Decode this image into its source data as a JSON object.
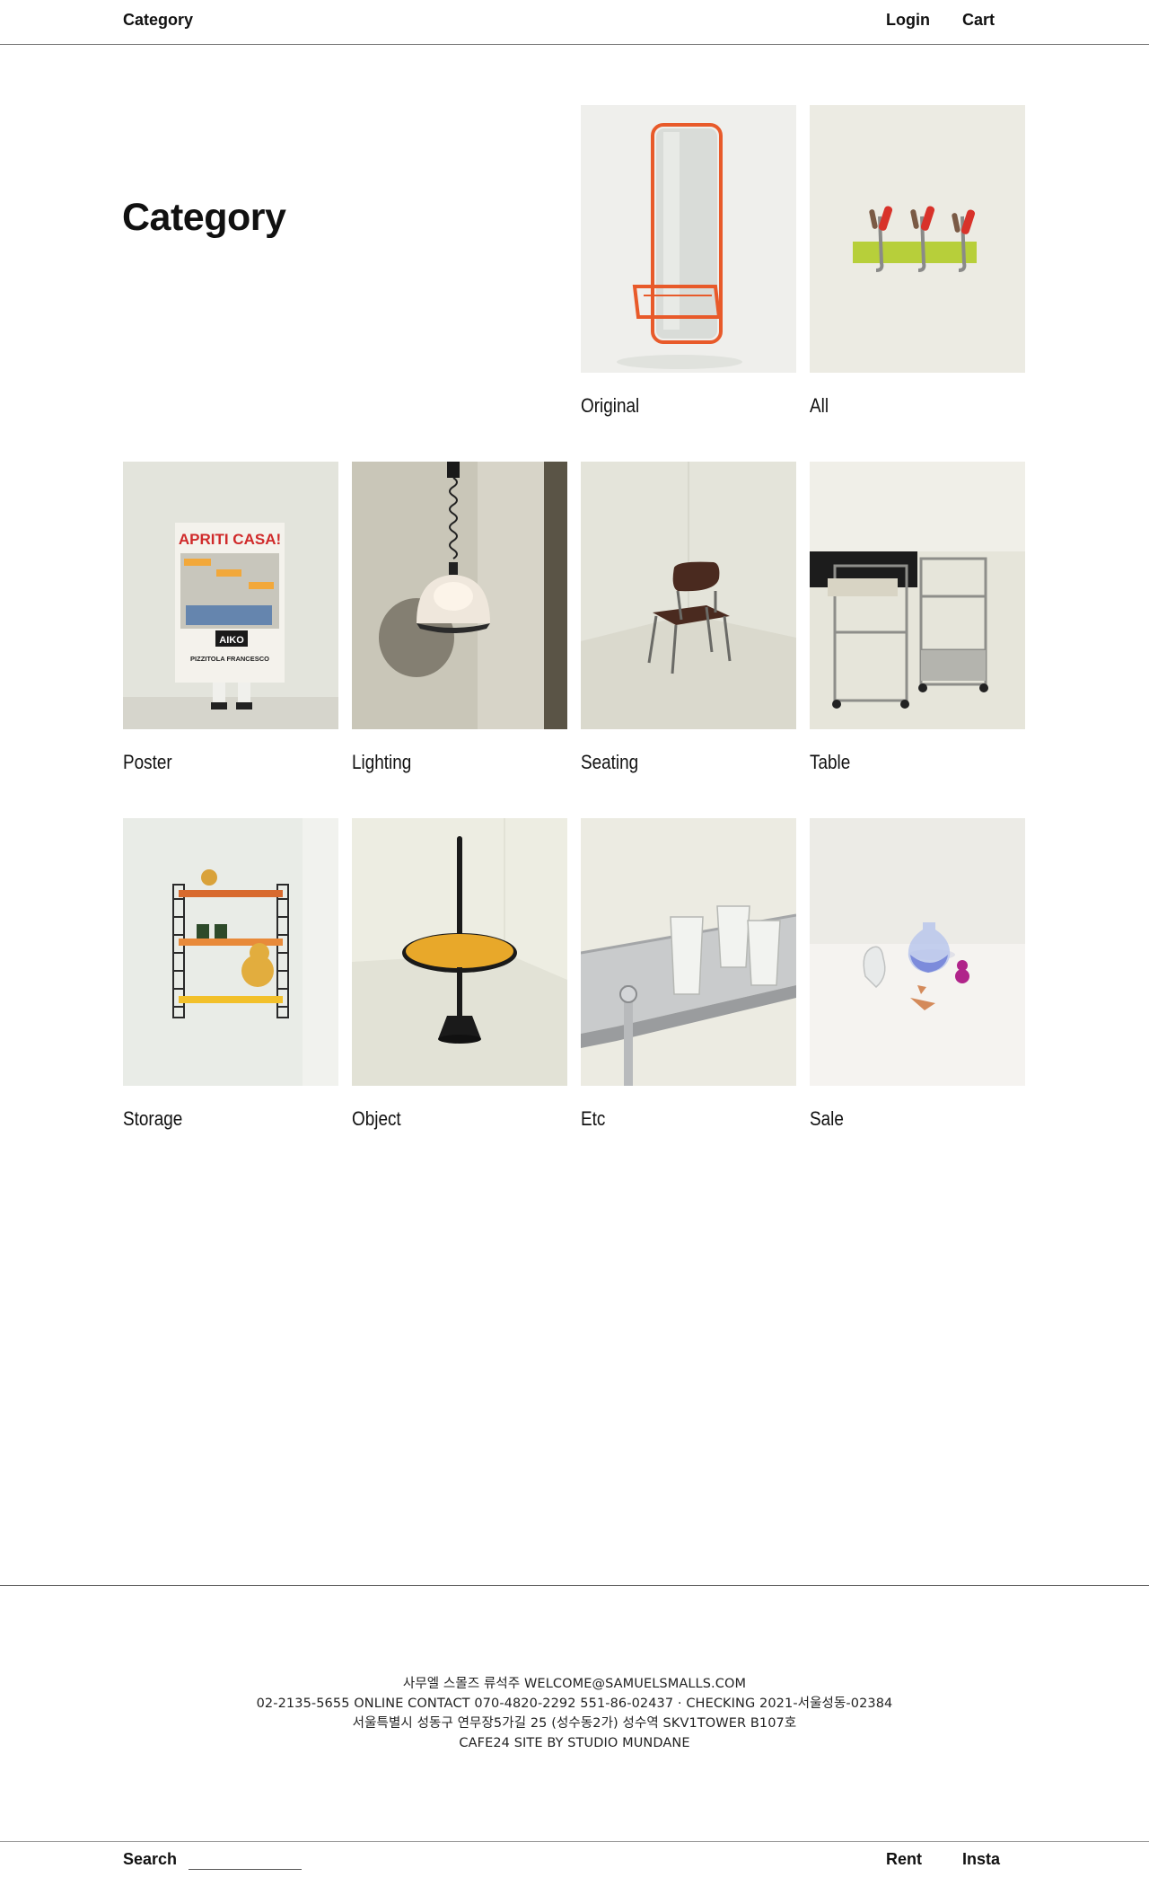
{
  "header": {
    "category_link": "Category",
    "login_link": "Login",
    "cart_link": "Cart"
  },
  "page_title": "Category",
  "categories": [
    {
      "label": "Original",
      "image_icon": "orange-mirror-photo"
    },
    {
      "label": "All",
      "image_icon": "wall-hooks-photo"
    },
    {
      "label": "Poster",
      "image_icon": "poster-photo"
    },
    {
      "label": "Lighting",
      "image_icon": "pendant-lamp-photo"
    },
    {
      "label": "Seating",
      "image_icon": "chair-photo"
    },
    {
      "label": "Table",
      "image_icon": "trolley-tables-photo"
    },
    {
      "label": "Storage",
      "image_icon": "wall-shelf-photo"
    },
    {
      "label": "Object",
      "image_icon": "side-table-photo"
    },
    {
      "label": "Etc",
      "image_icon": "glasses-on-cart-photo"
    },
    {
      "label": "Sale",
      "image_icon": "glass-objects-photo"
    }
  ],
  "poster_text": {
    "headline": "APRITI CASA!",
    "brand": "AIKO",
    "shop": "PIZZITOLA FRANCESCO"
  },
  "footer": {
    "line1": "사무엘 스몰즈 류석주 WELCOME@SAMUELSMALLS.COM",
    "line2": "02-2135-5655 ONLINE CONTACT 070-4820-2292 551-86-02437 · CHECKING 2021-서울성동-02384",
    "line3": "서울특별시 성동구 연무장5가길 25 (성수동2가) 성수역 SKV1TOWER B107호",
    "line4": "CAFE24 SITE BY STUDIO MUNDANE"
  },
  "bottom_bar": {
    "search_label": "Search",
    "search_value": "",
    "rent_link": "Rent",
    "insta_link": "Insta"
  }
}
